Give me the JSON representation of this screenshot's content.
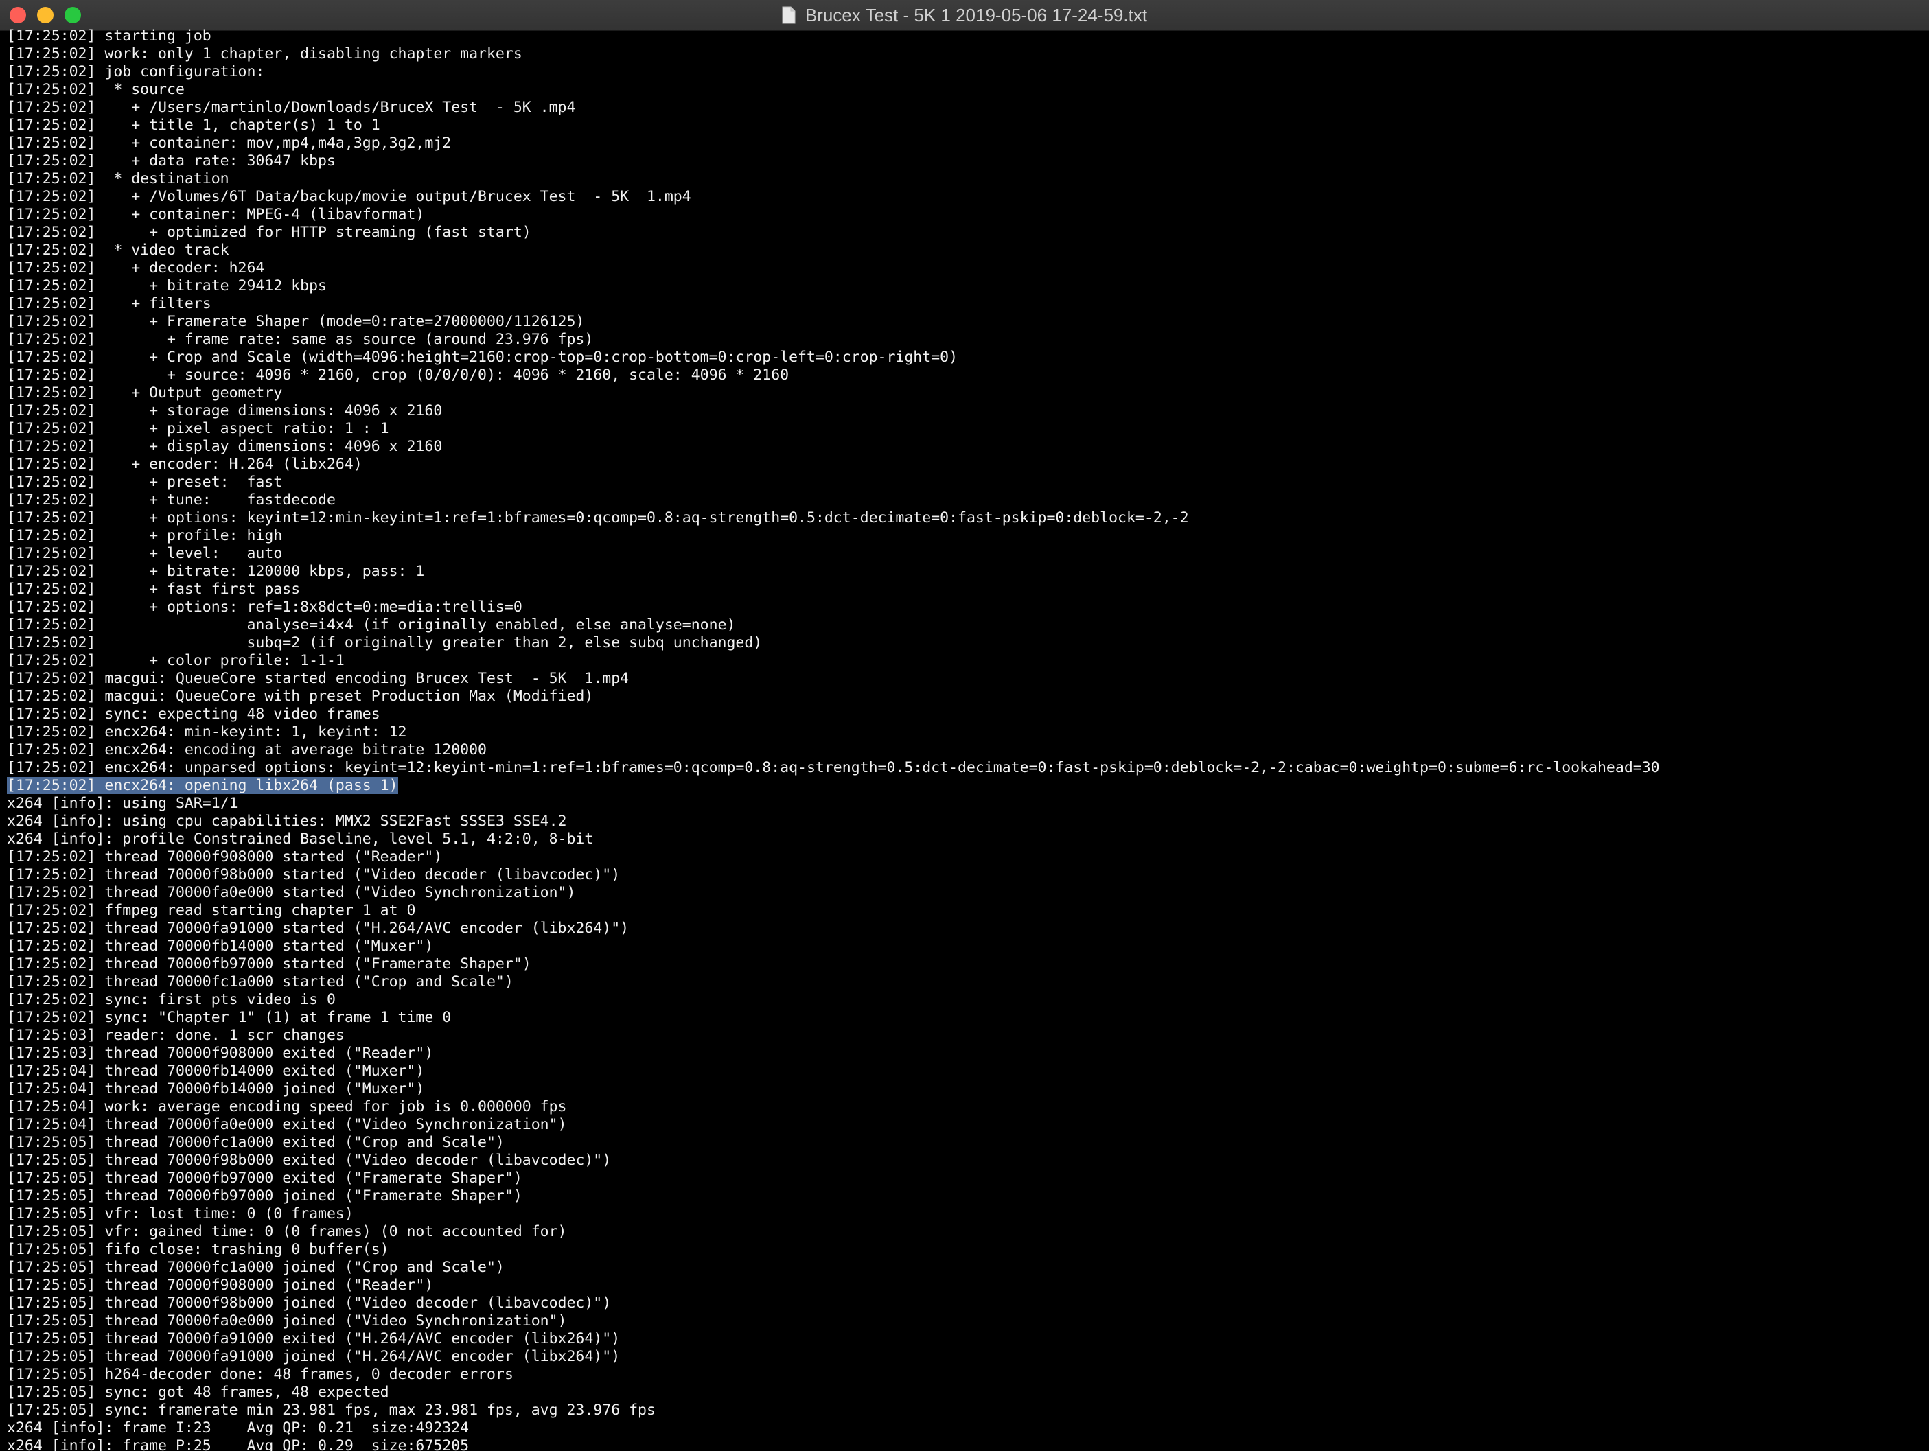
{
  "window": {
    "title": "Brucex Test  - 5K  1 2019-05-06 17-24-59.txt",
    "document_icon": "document-icon",
    "selected_line_index": 42,
    "colors": {
      "background": "#000000",
      "text": "#f2f2f2",
      "selection": "#4b6a97",
      "close": "#fe5f57",
      "minimize": "#febc2e",
      "zoom": "#28c840"
    }
  },
  "log_lines": [
    "[17:25:02] starting job",
    "[17:25:02] work: only 1 chapter, disabling chapter markers",
    "[17:25:02] job configuration:",
    "[17:25:02]  * source",
    "[17:25:02]    + /Users/martinlo/Downloads/BruceX Test  - 5K .mp4",
    "[17:25:02]    + title 1, chapter(s) 1 to 1",
    "[17:25:02]    + container: mov,mp4,m4a,3gp,3g2,mj2",
    "[17:25:02]    + data rate: 30647 kbps",
    "[17:25:02]  * destination",
    "[17:25:02]    + /Volumes/6T Data/backup/movie output/Brucex Test  - 5K  1.mp4",
    "[17:25:02]    + container: MPEG-4 (libavformat)",
    "[17:25:02]      + optimized for HTTP streaming (fast start)",
    "[17:25:02]  * video track",
    "[17:25:02]    + decoder: h264",
    "[17:25:02]      + bitrate 29412 kbps",
    "[17:25:02]    + filters",
    "[17:25:02]      + Framerate Shaper (mode=0:rate=27000000/1126125)",
    "[17:25:02]        + frame rate: same as source (around 23.976 fps)",
    "[17:25:02]      + Crop and Scale (width=4096:height=2160:crop-top=0:crop-bottom=0:crop-left=0:crop-right=0)",
    "[17:25:02]        + source: 4096 * 2160, crop (0/0/0/0): 4096 * 2160, scale: 4096 * 2160",
    "[17:25:02]    + Output geometry",
    "[17:25:02]      + storage dimensions: 4096 x 2160",
    "[17:25:02]      + pixel aspect ratio: 1 : 1",
    "[17:25:02]      + display dimensions: 4096 x 2160",
    "[17:25:02]    + encoder: H.264 (libx264)",
    "[17:25:02]      + preset:  fast",
    "[17:25:02]      + tune:    fastdecode",
    "[17:25:02]      + options: keyint=12:min-keyint=1:ref=1:bframes=0:qcomp=0.8:aq-strength=0.5:dct-decimate=0:fast-pskip=0:deblock=-2,-2",
    "[17:25:02]      + profile: high",
    "[17:25:02]      + level:   auto",
    "[17:25:02]      + bitrate: 120000 kbps, pass: 1",
    "[17:25:02]      + fast first pass",
    "[17:25:02]      + options: ref=1:8x8dct=0:me=dia:trellis=0",
    "[17:25:02]                 analyse=i4x4 (if originally enabled, else analyse=none)",
    "[17:25:02]                 subq=2 (if originally greater than 2, else subq unchanged)",
    "[17:25:02]      + color profile: 1-1-1",
    "[17:25:02] macgui: QueueCore started encoding Brucex Test  - 5K  1.mp4",
    "[17:25:02] macgui: QueueCore with preset Production Max (Modified)",
    "[17:25:02] sync: expecting 48 video frames",
    "[17:25:02] encx264: min-keyint: 1, keyint: 12",
    "[17:25:02] encx264: encoding at average bitrate 120000",
    "[17:25:02] encx264: unparsed options: keyint=12:keyint-min=1:ref=1:bframes=0:qcomp=0.8:aq-strength=0.5:dct-decimate=0:fast-pskip=0:deblock=-2,-2:cabac=0:weightp=0:subme=6:rc-lookahead=30",
    "[17:25:02] encx264: opening libx264 (pass 1)",
    "x264 [info]: using SAR=1/1",
    "x264 [info]: using cpu capabilities: MMX2 SSE2Fast SSSE3 SSE4.2",
    "x264 [info]: profile Constrained Baseline, level 5.1, 4:2:0, 8-bit",
    "[17:25:02] thread 70000f908000 started (\"Reader\")",
    "[17:25:02] thread 70000f98b000 started (\"Video decoder (libavcodec)\")",
    "[17:25:02] thread 70000fa0e000 started (\"Video Synchronization\")",
    "[17:25:02] ffmpeg_read starting chapter 1 at 0",
    "[17:25:02] thread 70000fa91000 started (\"H.264/AVC encoder (libx264)\")",
    "[17:25:02] thread 70000fb14000 started (\"Muxer\")",
    "[17:25:02] thread 70000fb97000 started (\"Framerate Shaper\")",
    "[17:25:02] thread 70000fc1a000 started (\"Crop and Scale\")",
    "[17:25:02] sync: first pts video is 0",
    "[17:25:02] sync: \"Chapter 1\" (1) at frame 1 time 0",
    "[17:25:03] reader: done. 1 scr changes",
    "[17:25:03] thread 70000f908000 exited (\"Reader\")",
    "[17:25:04] thread 70000fb14000 exited (\"Muxer\")",
    "[17:25:04] thread 70000fb14000 joined (\"Muxer\")",
    "[17:25:04] work: average encoding speed for job is 0.000000 fps",
    "[17:25:04] thread 70000fa0e000 exited (\"Video Synchronization\")",
    "[17:25:05] thread 70000fc1a000 exited (\"Crop and Scale\")",
    "[17:25:05] thread 70000f98b000 exited (\"Video decoder (libavcodec)\")",
    "[17:25:05] thread 70000fb97000 exited (\"Framerate Shaper\")",
    "[17:25:05] thread 70000fb97000 joined (\"Framerate Shaper\")",
    "[17:25:05] vfr: lost time: 0 (0 frames)",
    "[17:25:05] vfr: gained time: 0 (0 frames) (0 not accounted for)",
    "[17:25:05] fifo_close: trashing 0 buffer(s)",
    "[17:25:05] thread 70000fc1a000 joined (\"Crop and Scale\")",
    "[17:25:05] thread 70000f908000 joined (\"Reader\")",
    "[17:25:05] thread 70000f98b000 joined (\"Video decoder (libavcodec)\")",
    "[17:25:05] thread 70000fa0e000 joined (\"Video Synchronization\")",
    "[17:25:05] thread 70000fa91000 exited (\"H.264/AVC encoder (libx264)\")",
    "[17:25:05] thread 70000fa91000 joined (\"H.264/AVC encoder (libx264)\")",
    "[17:25:05] h264-decoder done: 48 frames, 0 decoder errors",
    "[17:25:05] sync: got 48 frames, 48 expected",
    "[17:25:05] sync: framerate min 23.981 fps, max 23.981 fps, avg 23.976 fps",
    "x264 [info]: frame I:23    Avg QP: 0.21  size:492324",
    "x264 [info]: frame P:25    Avg QP: 0.29  size:675205"
  ]
}
